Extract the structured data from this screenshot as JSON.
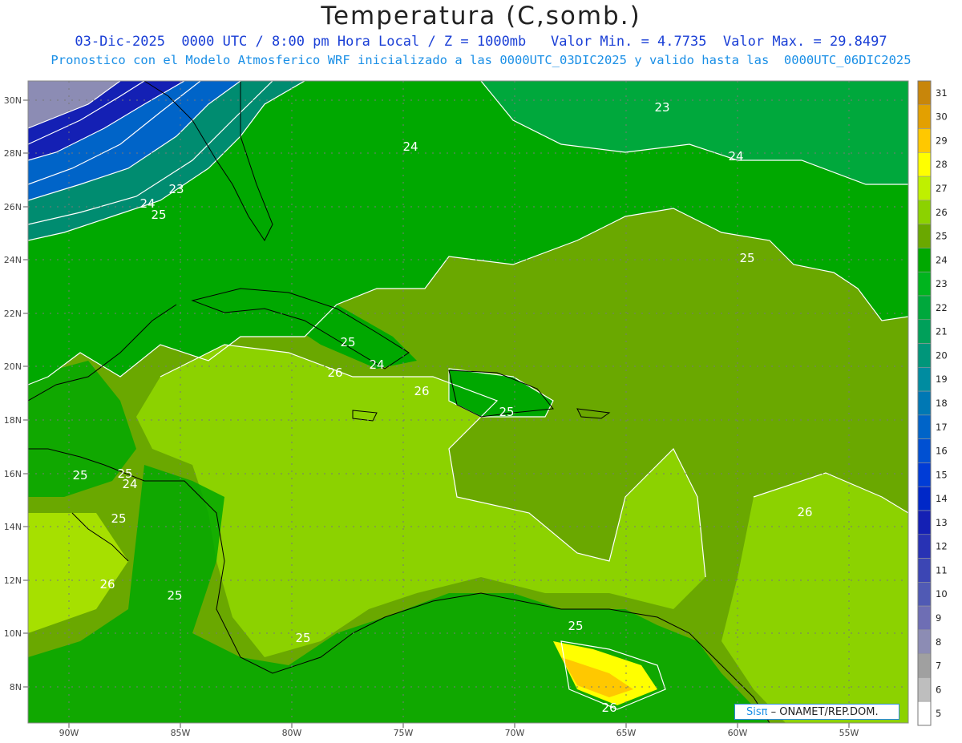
{
  "title": "Temperatura (C,somb.)",
  "subtitle_line1": "03-Dic-2025  0000 UTC / 8:00 pm Hora Local / Z = 1000mb   Valor Min. = 4.7735  Valor Max. = 29.8497",
  "subtitle_line2": "Pronostico con el Modelo Atmosferico WRF inicializado a las 0000UTC_03DIC2025 y valido hasta las  0000UTC_06DIC2025",
  "lat_labels": [
    "30N",
    "28N",
    "26N",
    "24N",
    "22N",
    "20N",
    "18N",
    "16N",
    "14N",
    "12N",
    "10N",
    "8N"
  ],
  "lon_labels": [
    "90W",
    "85W",
    "80W",
    "75W",
    "70W",
    "65W",
    "60W",
    "55W"
  ],
  "colorbar": {
    "labels": [
      "31",
      "30",
      "29",
      "28",
      "27",
      "26",
      "25",
      "24",
      "23",
      "22",
      "21",
      "20",
      "19",
      "18",
      "17",
      "16",
      "15",
      "14",
      "13",
      "12",
      "11",
      "10",
      "9",
      "8",
      "7",
      "6",
      "5"
    ],
    "colors": [
      "#c8860a",
      "#e3a000",
      "#ffc800",
      "#ffff00",
      "#bff000",
      "#8cd200",
      "#6aa800",
      "#00a800",
      "#00b41e",
      "#00a83c",
      "#00a05a",
      "#00967a",
      "#008ca0",
      "#0078b4",
      "#0064c8",
      "#0050d2",
      "#003cd6",
      "#0028c8",
      "#1420b4",
      "#2832b4",
      "#3c46b4",
      "#505ab4",
      "#6e6eb4",
      "#8c8cb4",
      "#a0a0a0",
      "#bebebe",
      "#ffffff"
    ]
  },
  "contour_labels": [
    "23",
    "24",
    "24",
    "23",
    "24",
    "25",
    "25",
    "25",
    "24",
    "26",
    "26",
    "25",
    "25",
    "24",
    "25",
    "26",
    "26",
    "26",
    "25",
    "25",
    "25",
    "25"
  ],
  "credit": {
    "sis": "Sisπ",
    "rest": " – ONAMET/REP.DOM."
  },
  "palette": {
    "ocean_26": "#6aa800",
    "ocean_27": "#8cd200",
    "ocean_24": "#00a800",
    "cold": "#0a0a9a"
  }
}
